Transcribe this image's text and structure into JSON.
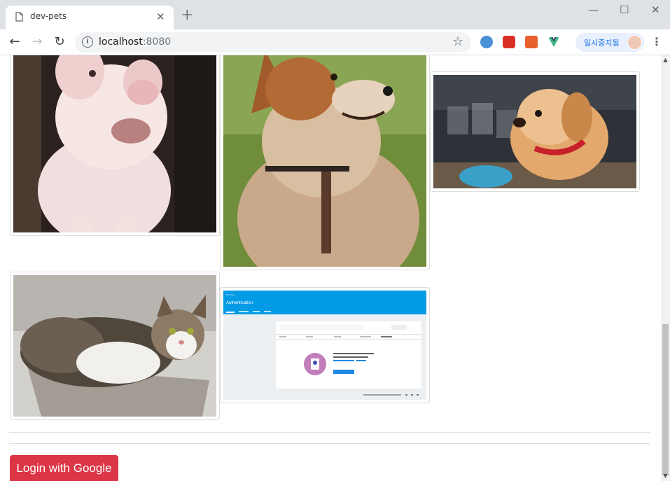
{
  "browser": {
    "tab_title": "dev-pets",
    "url_host": "localhost",
    "url_port": ":8080",
    "profile_label": "일시중지됨"
  },
  "gallery": {
    "items": [
      {
        "subject": "pig"
      },
      {
        "subject": "dog"
      },
      {
        "subject": "puppy"
      },
      {
        "subject": "cat"
      },
      {
        "subject": "screenshot"
      }
    ]
  },
  "screenshot_thumb": {
    "header_title": "Authentication"
  },
  "login_button": "Login with Google",
  "colors": {
    "login": "#dc3545",
    "thumb_header": "#039be5",
    "tabbar": "#dee1e6"
  }
}
